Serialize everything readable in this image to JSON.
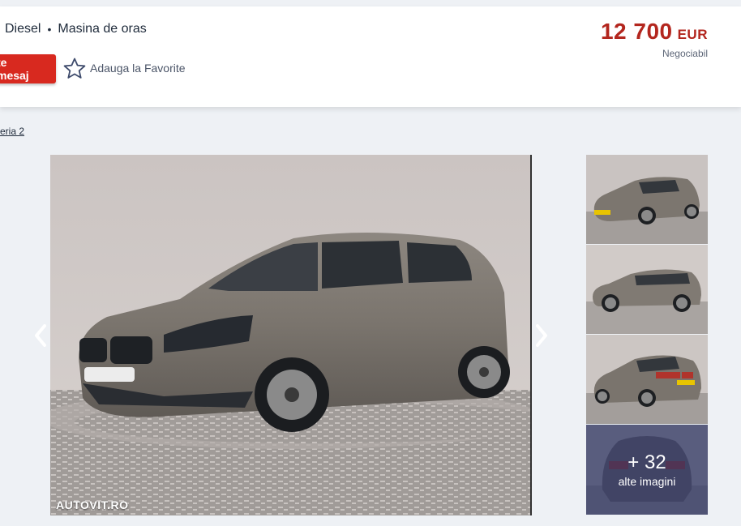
{
  "header": {
    "specs": [
      "Diesel",
      "Masina de oras"
    ],
    "message_button": "te mesaj",
    "favorite_label": "Adauga la Favorite",
    "price_value": "12 700",
    "price_currency": "EUR",
    "price_note": "Negociabil"
  },
  "breadcrumb": {
    "text": "eria 2"
  },
  "gallery": {
    "watermark": "AUTOVIT.RO",
    "more_count": "+ 32",
    "more_label": "alte imagini",
    "prev_icon": "chevron-left-icon",
    "next_icon": "chevron-right-icon"
  },
  "colors": {
    "accent_red": "#d8291f",
    "price_red": "#b3261e",
    "page_bg": "#eef1f5",
    "overlay": "#303866"
  }
}
